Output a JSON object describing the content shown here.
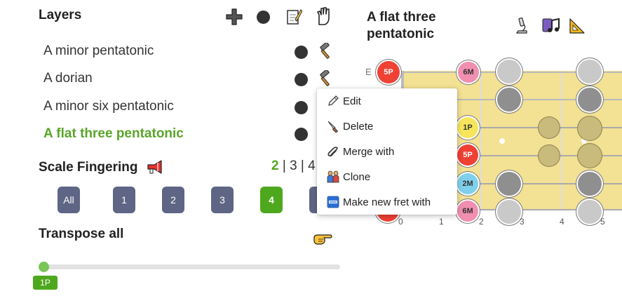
{
  "layers": {
    "title": "Layers",
    "items": [
      {
        "label": "A minor pentatonic",
        "active": false
      },
      {
        "label": "A dorian",
        "active": false
      },
      {
        "label": "A minor six pentatonic",
        "active": false
      },
      {
        "label": "A flat three pentatonic",
        "active": true
      }
    ]
  },
  "scale_fingering": {
    "title": "Scale Fingering",
    "count_active": "2",
    "count_rest": "| 3 | 4",
    "buttons": [
      "All",
      "1",
      "2",
      "3",
      "4",
      "5"
    ],
    "selected": "4"
  },
  "transpose": {
    "title": "Transpose all",
    "value_label": "1P",
    "value": 0
  },
  "fretboard": {
    "title_line1": "A flat three",
    "title_line2": "pentatonic",
    "string_label": "E",
    "fret_numbers": [
      "0",
      "1",
      "2",
      "3",
      "4",
      "5"
    ],
    "note_labels": {
      "fivep": "5P",
      "sixm": "6M",
      "onep": "1P",
      "twom": "2M"
    }
  },
  "context_menu": {
    "items": [
      {
        "label": "Edit",
        "icon": "pencil-icon"
      },
      {
        "label": "Delete",
        "icon": "knife-icon"
      },
      {
        "label": "Merge with",
        "icon": "paperclip-icon"
      },
      {
        "label": "Clone",
        "icon": "twins-icon"
      },
      {
        "label": "Make new fret with",
        "icon": "new-badge-icon"
      }
    ]
  },
  "colors": {
    "accent_green": "#4ea81d",
    "fingering_button": "#5e6585",
    "fretboard_wood": "#f3e194",
    "note_red": "#ef4134",
    "note_pink": "#f18fb1",
    "note_yellow": "#f7e65d",
    "note_blue": "#7fd0ec"
  }
}
